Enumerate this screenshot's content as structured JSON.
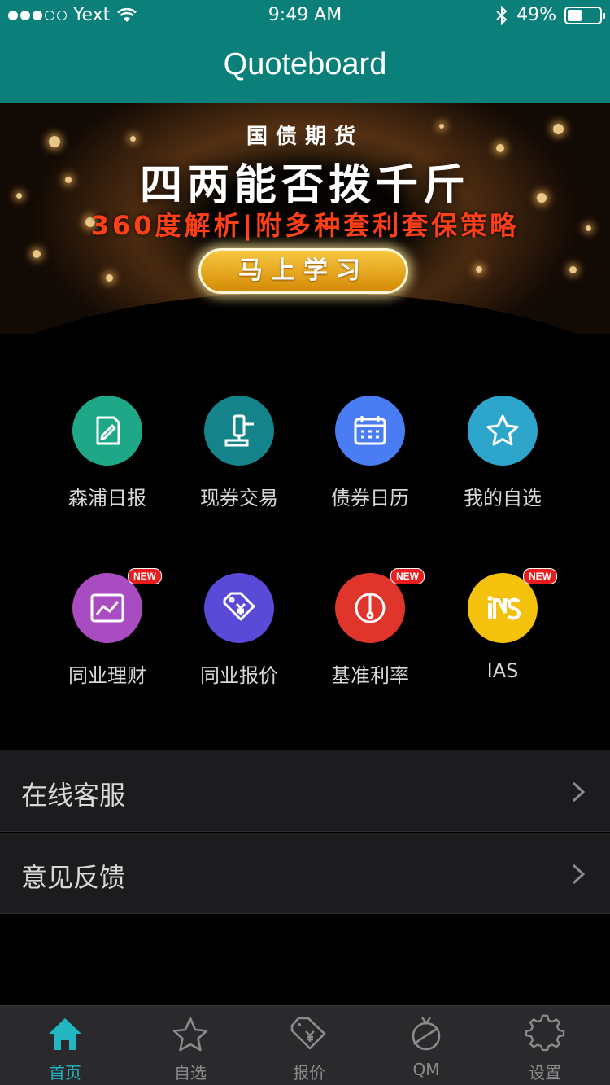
{
  "status_bar": {
    "carrier": "Yext",
    "time": "9:49 AM",
    "battery": "49%",
    "battery_level": 0.49
  },
  "nav": {
    "title": "Quoteboard"
  },
  "banner": {
    "kicker": "国债期货",
    "headline": "四两能否拨千斤",
    "sub": "360度解析|附多种套利套保策略",
    "cta": "马上学习"
  },
  "grid": [
    {
      "label": "森浦日报",
      "icon": "edit-document-icon",
      "color": "#1fa887",
      "badge": ""
    },
    {
      "label": "现券交易",
      "icon": "gavel-icon",
      "color": "#14838a",
      "badge": ""
    },
    {
      "label": "债券日历",
      "icon": "calendar-icon",
      "color": "#4a7cf4",
      "badge": ""
    },
    {
      "label": "我的自选",
      "icon": "star-icon",
      "color": "#2ea6cb",
      "badge": ""
    },
    {
      "label": "同业理财",
      "icon": "trend-chart-icon",
      "color": "#a94bc1",
      "badge": "NEW"
    },
    {
      "label": "同业报价",
      "icon": "yen-tag-icon",
      "color": "#5a4ad8",
      "badge": ""
    },
    {
      "label": "基准利率",
      "icon": "gauge-icon",
      "color": "#e0352b",
      "badge": "NEW"
    },
    {
      "label": "IAS",
      "icon": "ins-logo-icon",
      "color": "#f4c20d",
      "badge": "NEW"
    }
  ],
  "list": [
    {
      "label": "在线客服"
    },
    {
      "label": "意见反馈"
    }
  ],
  "tabs": [
    {
      "label": "首页",
      "icon": "home-icon",
      "active": true
    },
    {
      "label": "自选",
      "icon": "star-icon",
      "active": false
    },
    {
      "label": "报价",
      "icon": "price-tag-icon",
      "active": false
    },
    {
      "label": "QM",
      "icon": "qm-planet-icon",
      "active": false
    },
    {
      "label": "设置",
      "icon": "gear-icon",
      "active": false
    }
  ],
  "colors": {
    "header": "#0b7f79",
    "tab_active": "#21b6c2",
    "tab_inactive": "#8b8b8d",
    "banner_sub": "#ff3f16"
  }
}
